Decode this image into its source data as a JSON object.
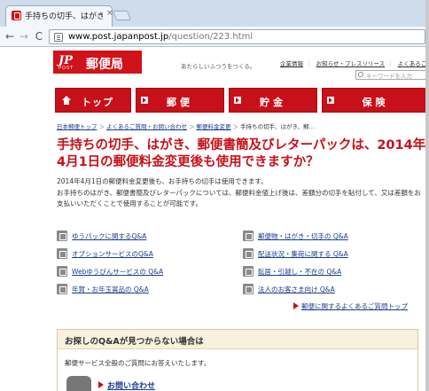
{
  "browser": {
    "tab_title": "手持ちの切手、はがき、郵",
    "tab_close": "×",
    "url_host": "www.post.japanpost.jp",
    "url_path": "/question/223.html",
    "back": "←",
    "forward": "→",
    "reload": "C"
  },
  "header": {
    "logo_mark": "JP",
    "logo_post": "POST",
    "logo_name": "郵便局",
    "tagline": "あたらしいふつうをつくる。",
    "links": [
      "企業情報",
      "お知らせ・プレスリリース",
      "よくあるご質問（Q"
    ],
    "search_placeholder": "キーワードを入力"
  },
  "gnav": [
    {
      "label": "トップ",
      "icon": "home-icon"
    },
    {
      "label": "郵便",
      "icon": "arrow-icon"
    },
    {
      "label": "貯金",
      "icon": "arrow-icon"
    },
    {
      "label": "保険",
      "icon": "arrow-icon"
    }
  ],
  "breadcrumb": {
    "items": [
      "日本郵便トップ",
      "よくあるご質問・お問い合わせ",
      "郵便料金変更",
      "手持ちの切手、はがき、郵…"
    ],
    "separator": "＞"
  },
  "question": {
    "title": "手持ちの切手、はがき、郵便書簡及びレターパックは、2014年4月1日の郵便料金変更後も使用できますか？",
    "answer_line1": "2014年4月1日の郵便料金変更後も、お手持ちの切手は使用できます。",
    "answer_line2": "お手持ちのはがき、郵便書簡及びレターパックについては、郵便料金値上げ後は、差額分の切手を貼付して、又は差額をお支払いいただくことで使用することが可能です。"
  },
  "qa_links": {
    "left": [
      "ゆうパックに関するQ&A",
      "オプションサービスのQ&A",
      "Webゆうびんサービスの Q&A",
      "年賀・お年玉賞品の Q&A"
    ],
    "right": [
      "郵便物・はがき・切手の Q&A",
      "配送状況・集荷に関する Q&A",
      "転居・引越し・不在の Q&A",
      "法人のお客さま向け Q&A"
    ]
  },
  "all_link": "郵便に関するよくあるご質問トップ",
  "help": {
    "title": "お探しのQ&Aが見つからない場合は",
    "text": "郵便サービス全般のご質問にお答えいたします。",
    "contact_label": "お問い合わせ"
  }
}
